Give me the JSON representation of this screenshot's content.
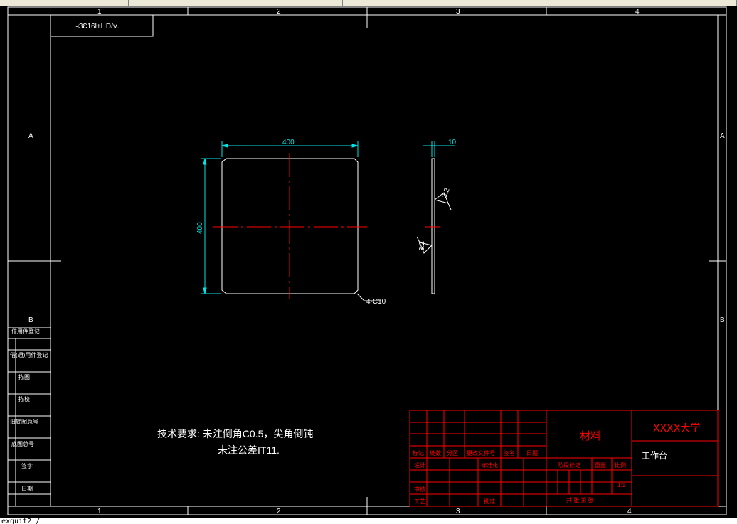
{
  "frame": {
    "col_labels": [
      "1",
      "2",
      "3",
      "4"
    ],
    "row_labels": [
      "A",
      "B"
    ],
    "top_left_box_text": "ⅎ3Ɛ16l+HD/ⅴ.",
    "sidebar": [
      "借用件登记",
      "旧底图总号",
      "底图总号",
      "描图",
      "描校",
      "签字",
      "日期",
      "借(通)用件登记"
    ]
  },
  "main_view": {
    "width_dim": "400",
    "height_dim": "400",
    "chamfer_note": "4-C10"
  },
  "side_view": {
    "thickness_dim": "10",
    "roughness_1": "3.2",
    "roughness_2": "3.2"
  },
  "notes": {
    "line1": "技术要求: 未注倒角C0.5，尖角倒钝",
    "line2": "未注公差IT11."
  },
  "title_block": {
    "material": "材料",
    "school": "XXXX大学",
    "part_name": "工作台",
    "row_labels": [
      "标记",
      "处数",
      "分区",
      "更改文件号",
      "签名",
      "日期"
    ],
    "design": "设计",
    "standardize": "标准化",
    "review": "审核",
    "process": "工艺",
    "approve": "批准",
    "stage_mark": "阶段标记",
    "weight": "重量",
    "scale": "比例",
    "scale_value": "1:1",
    "sheets": "共 张    第 张"
  },
  "command_line": "exquit2 /"
}
